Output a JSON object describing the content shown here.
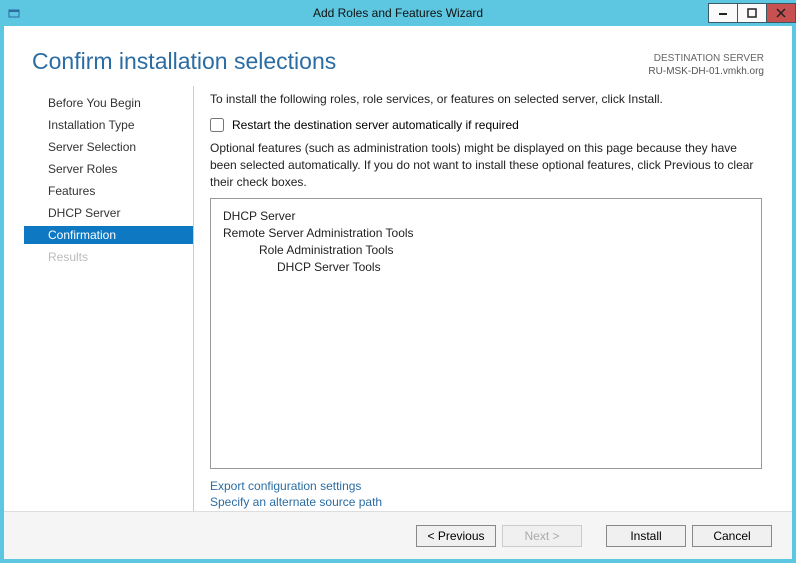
{
  "window": {
    "title": "Add Roles and Features Wizard"
  },
  "header": {
    "title": "Confirm installation selections",
    "dest_label": "DESTINATION SERVER",
    "dest_value": "RU-MSK-DH-01.vmkh.org"
  },
  "sidebar": {
    "items": [
      {
        "label": "Before You Begin",
        "state": "normal"
      },
      {
        "label": "Installation Type",
        "state": "normal"
      },
      {
        "label": "Server Selection",
        "state": "normal"
      },
      {
        "label": "Server Roles",
        "state": "normal"
      },
      {
        "label": "Features",
        "state": "normal"
      },
      {
        "label": "DHCP Server",
        "state": "normal"
      },
      {
        "label": "Confirmation",
        "state": "selected"
      },
      {
        "label": "Results",
        "state": "disabled"
      }
    ]
  },
  "panel": {
    "intro": "To install the following roles, role services, or features on selected server, click Install.",
    "restart_label": "Restart the destination server automatically if required",
    "restart_checked": false,
    "optional_text": "Optional features (such as administration tools) might be displayed on this page because they have been selected automatically. If you do not want to install these optional features, click Previous to clear their check boxes.",
    "selections": [
      {
        "text": "DHCP Server",
        "indent": 0
      },
      {
        "text": "Remote Server Administration Tools",
        "indent": 0
      },
      {
        "text": "Role Administration Tools",
        "indent": 1
      },
      {
        "text": "DHCP Server Tools",
        "indent": 2
      }
    ],
    "links": {
      "export": "Export configuration settings",
      "alt_source": "Specify an alternate source path"
    }
  },
  "footer": {
    "previous": "< Previous",
    "next": "Next >",
    "install": "Install",
    "cancel": "Cancel"
  }
}
